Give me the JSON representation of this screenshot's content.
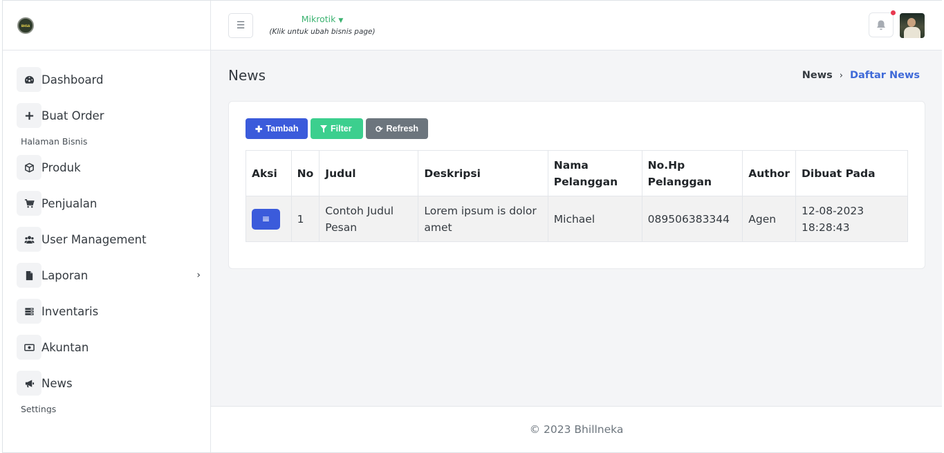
{
  "brand": {
    "logo_text": "BHSA"
  },
  "sidebar": {
    "items": [
      {
        "label": "Dashboard",
        "icon": "gauge-icon"
      },
      {
        "label": "Buat Order",
        "icon": "plus-icon"
      },
      {
        "label": "Produk",
        "icon": "box-icon"
      },
      {
        "label": "Penjualan",
        "icon": "cart-icon"
      },
      {
        "label": "User Management",
        "icon": "users-icon"
      },
      {
        "label": "Laporan",
        "icon": "file-icon",
        "has_submenu": true
      },
      {
        "label": "Inventaris",
        "icon": "server-icon"
      },
      {
        "label": "Akuntan",
        "icon": "money-icon"
      },
      {
        "label": "News",
        "icon": "megaphone-icon"
      }
    ],
    "sections": {
      "business": "Halaman Bisnis",
      "settings": "Settings"
    }
  },
  "header": {
    "business_name": "Mikrotik",
    "business_hint": "(Klik untuk ubah bisnis page)"
  },
  "page": {
    "title": "News",
    "breadcrumb": {
      "home": "News",
      "current": "Daftar News"
    }
  },
  "toolbar": {
    "add_label": "Tambah",
    "filter_label": "Filter",
    "refresh_label": "Refresh"
  },
  "table": {
    "columns": [
      "Aksi",
      "No",
      "Judul",
      "Deskripsi",
      "Nama Pelanggan",
      "No.Hp Pelanggan",
      "Author",
      "Dibuat Pada"
    ],
    "rows": [
      {
        "no": "1",
        "judul": "Contoh Judul Pesan",
        "deskripsi": "Lorem ipsum is dolor amet",
        "nama": "Michael",
        "hp": "089506383344",
        "author": "Agen",
        "dibuat": "12-08-2023 18:28:43"
      }
    ]
  },
  "footer": {
    "text": "© 2023 Bhillneka"
  },
  "colors": {
    "primary": "#3b5bdb",
    "success": "#3ccf8e",
    "secondary": "#6c757d",
    "accent_link": "#3f6ad8",
    "business_green": "#3cb371",
    "notification": "#e8384f"
  }
}
